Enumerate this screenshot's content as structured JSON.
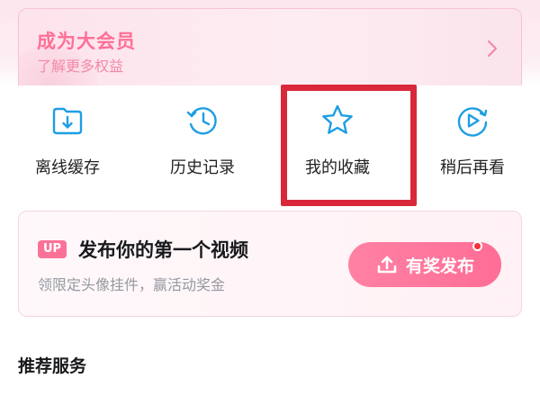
{
  "vip": {
    "title": "成为大会员",
    "subtitle": "了解更多权益",
    "chevron_icon": "chevron-right-icon"
  },
  "actions": [
    {
      "label": "离线缓存",
      "icon": "download-folder-icon",
      "color": "#1e9ee3"
    },
    {
      "label": "历史记录",
      "icon": "history-clock-icon",
      "color": "#1e9ee3"
    },
    {
      "label": "我的收藏",
      "icon": "star-icon",
      "color": "#1e9ee3",
      "highlighted": true
    },
    {
      "label": "稍后再看",
      "icon": "watch-later-icon",
      "color": "#1e9ee3"
    }
  ],
  "upload_card": {
    "badge": "UP",
    "title": "发布你的第一个视频",
    "subtitle": "领限定头像挂件，赢活动奖金",
    "button_label": "有奖发布",
    "button_icon": "upload-icon",
    "has_notification_dot": true
  },
  "section": {
    "title": "推荐服务"
  },
  "colors": {
    "brand_pink": "#fb7299",
    "accent_blue": "#1e9ee3",
    "highlight_red": "#d9283a"
  }
}
